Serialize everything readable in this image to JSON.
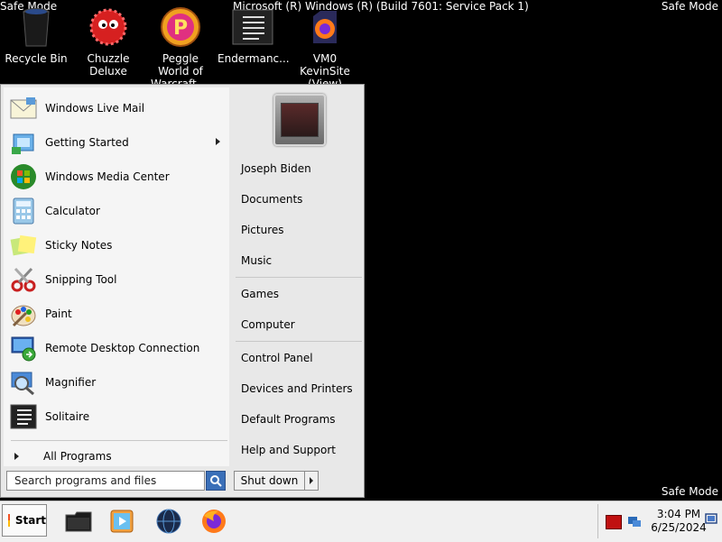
{
  "overlay": {
    "safe_mode_tl": "Safe Mode",
    "safe_mode_tr": "Safe Mode",
    "safe_mode_br": "Safe Mode",
    "window_title": "Microsoft (R) Windows (R) (Build 7601: Service Pack 1)"
  },
  "desktop_icons": [
    {
      "label": "Recycle Bin",
      "icon": "recycle-bin-icon"
    },
    {
      "label": "Chuzzle Deluxe",
      "icon": "chuzzle-icon"
    },
    {
      "label": "Peggle World of Warcraft ...",
      "icon": "peggle-icon"
    },
    {
      "label": "Endermanc...",
      "icon": "document-icon"
    },
    {
      "label": "VM0 KevinSite (View)",
      "icon": "firefox-icon"
    }
  ],
  "start_menu": {
    "programs": [
      {
        "label": "Windows Live Mail",
        "icon": "mail-icon",
        "has_submenu": false
      },
      {
        "label": "Getting Started",
        "icon": "getting-started-icon",
        "has_submenu": true
      },
      {
        "label": "Windows Media Center",
        "icon": "media-center-icon",
        "has_submenu": false
      },
      {
        "label": "Calculator",
        "icon": "calculator-icon",
        "has_submenu": false
      },
      {
        "label": "Sticky Notes",
        "icon": "sticky-notes-icon",
        "has_submenu": false
      },
      {
        "label": "Snipping Tool",
        "icon": "scissors-icon",
        "has_submenu": false
      },
      {
        "label": "Paint",
        "icon": "paint-icon",
        "has_submenu": false
      },
      {
        "label": "Remote Desktop Connection",
        "icon": "remote-desktop-icon",
        "has_submenu": false
      },
      {
        "label": "Magnifier",
        "icon": "magnifier-icon",
        "has_submenu": false
      },
      {
        "label": "Solitaire",
        "icon": "solitaire-icon",
        "has_submenu": false
      }
    ],
    "all_programs": "All Programs",
    "search_placeholder": "Search programs and files",
    "right_items": [
      "Joseph Biden",
      "Documents",
      "Pictures",
      "Music",
      "Games",
      "Computer",
      "Control Panel",
      "Devices and Printers",
      "Default Programs",
      "Help and Support"
    ],
    "shutdown_label": "Shut down"
  },
  "taskbar": {
    "start_label": "Start",
    "time": "3:04 PM",
    "date": "6/25/2024"
  }
}
